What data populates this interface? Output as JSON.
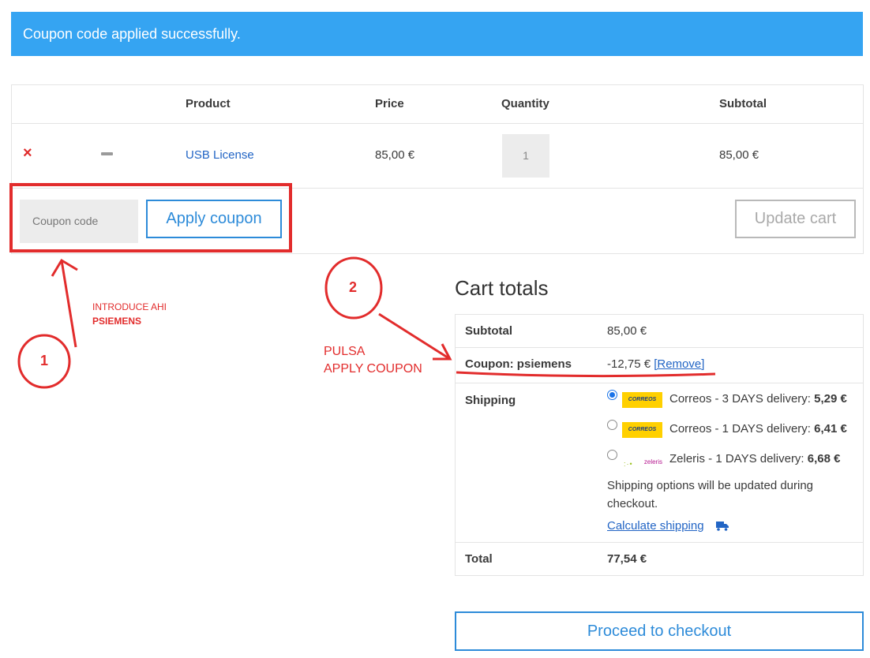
{
  "notice": {
    "message": "Coupon code applied successfully."
  },
  "cart": {
    "headers": {
      "product": "Product",
      "price": "Price",
      "quantity": "Quantity",
      "subtotal": "Subtotal"
    },
    "item": {
      "remove": "×",
      "name": "USB License",
      "price": "85,00 €",
      "quantity": "1",
      "subtotal": "85,00 €"
    },
    "coupon_placeholder": "Coupon code",
    "apply_label": "Apply coupon",
    "update_label": "Update cart"
  },
  "totals": {
    "title": "Cart totals",
    "subtotal_label": "Subtotal",
    "subtotal_value": "85,00 €",
    "coupon_label": "Coupon: psiemens",
    "coupon_value": "-12,75 €",
    "coupon_remove": "[Remove]",
    "shipping_label": "Shipping",
    "shipping_options": [
      {
        "name": "Correos - 3 DAYS delivery: ",
        "price": "5,29 €",
        "logo": "CORREOS",
        "selected": true
      },
      {
        "name": "Correos - 1 DAYS delivery: ",
        "price": "6,41 €",
        "logo": "CORREOS",
        "selected": false
      },
      {
        "name": "Zeleris - 1 DAYS delivery: ",
        "price": "6,68 €",
        "logo": "zeleris",
        "selected": false
      }
    ],
    "shipping_note": "Shipping options will be updated during checkout.",
    "calculate_label": "Calculate shipping",
    "total_label": "Total",
    "total_value": "77,54 €"
  },
  "checkout_label": "Proceed to checkout",
  "annotations": {
    "step1_number": "1",
    "step1_line1": "INTRODUCE AHI",
    "step1_line2": "PSIEMENS",
    "step2_number": "2",
    "step2_line1": "PULSA",
    "step2_line2": "APPLY COUPON"
  },
  "colors": {
    "notice_bg": "#35a4f2",
    "accent": "#2d8bd9",
    "link": "#2265c5",
    "annotation": "#e22c2c",
    "remove": "#e02b2b"
  }
}
